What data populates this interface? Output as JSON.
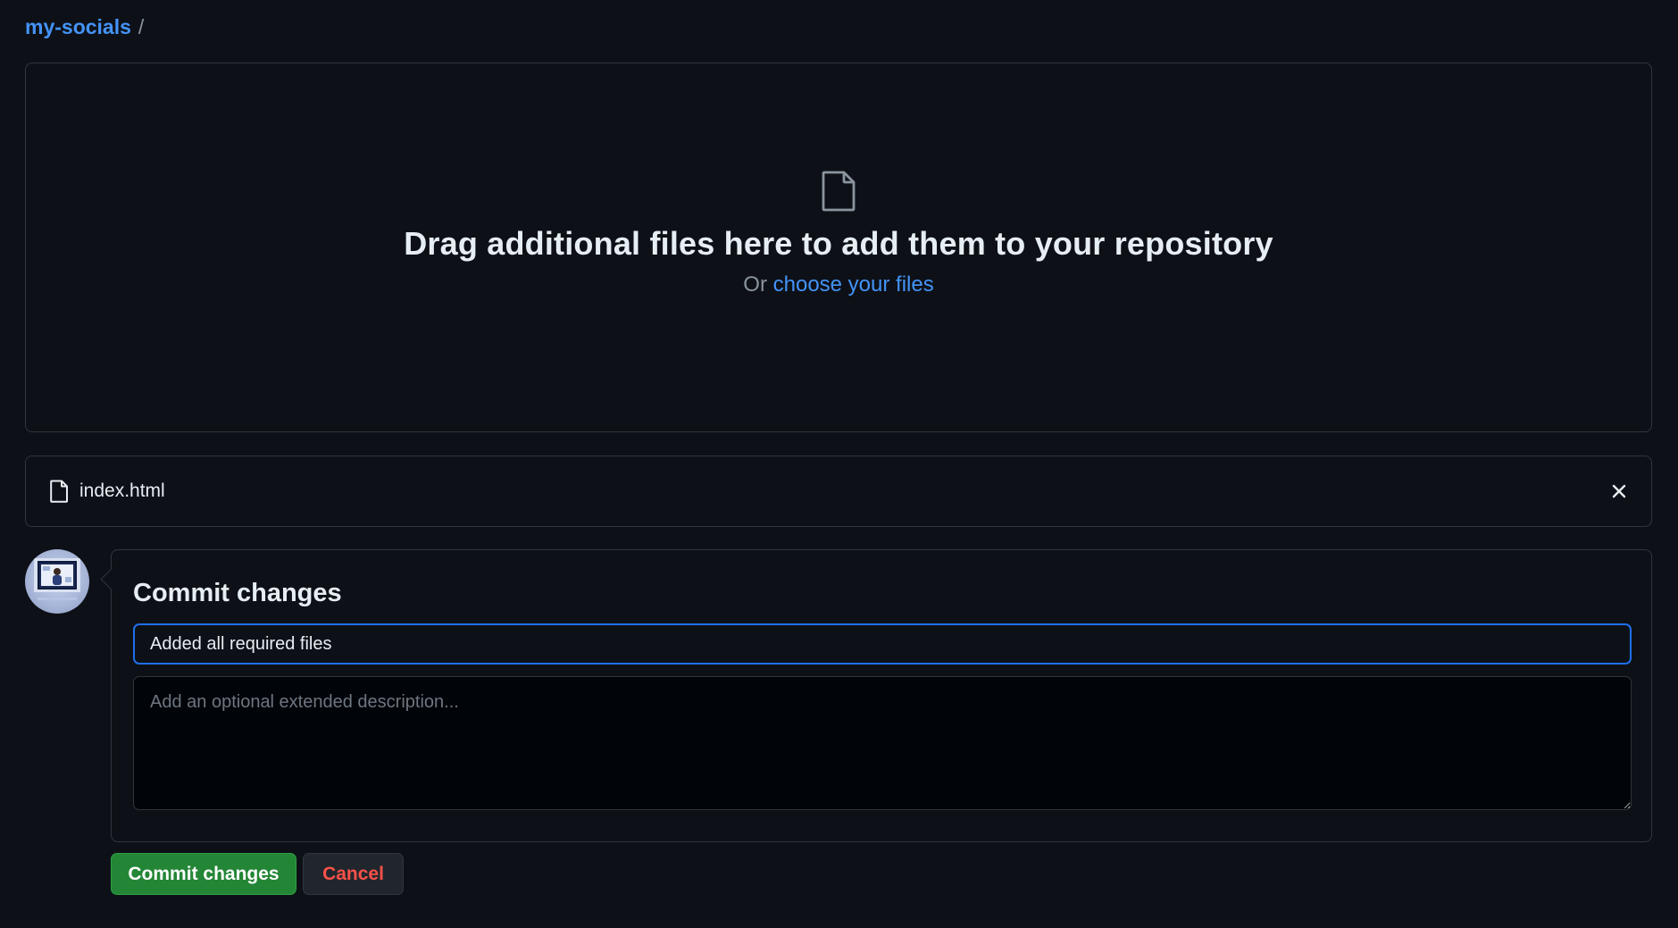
{
  "breadcrumb": {
    "repo": "my-socials",
    "separator": "/"
  },
  "dropzone": {
    "title": "Drag additional files here to add them to your repository",
    "sub_prefix": "Or",
    "choose_link": "choose your files",
    "icon": "file-icon"
  },
  "files": [
    {
      "name": "index.html",
      "icon": "file-icon",
      "remove_icon": "close-icon"
    }
  ],
  "commit": {
    "title": "Commit changes",
    "summary_value": "Added all required files",
    "description_placeholder": "Add an optional extended description..."
  },
  "buttons": {
    "commit_label": "Commit changes",
    "cancel_label": "Cancel"
  },
  "colors": {
    "background": "#0d1117",
    "link": "#4493f8",
    "border": "#30363d",
    "commit_button": "#238636",
    "cancel_text": "#f85149",
    "focus_border": "#1f6feb"
  }
}
